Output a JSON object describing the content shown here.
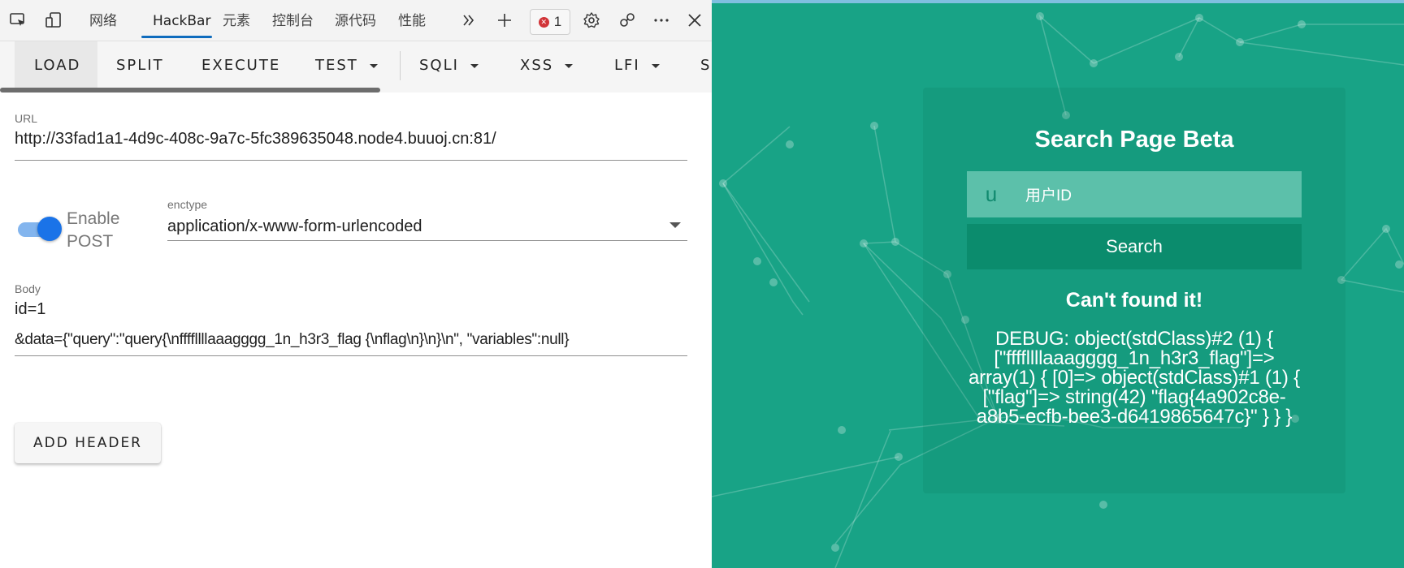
{
  "devtools": {
    "tabs": [
      "网络",
      "HackBar",
      "元素",
      "控制台",
      "源代码",
      "性能"
    ],
    "active_tab": "HackBar",
    "error_count": "1",
    "toolbar": {
      "load": "LOAD",
      "split": "SPLIT",
      "execute": "EXECUTE",
      "test": "TEST",
      "sqli": "SQLI",
      "xss": "XSS",
      "lfi": "LFI",
      "more": "S"
    },
    "url": {
      "label": "URL",
      "value": "http://33fad1a1-4d9c-408c-9a7c-5fc389635048.node4.buuoj.cn:81/"
    },
    "post": {
      "toggle_label": "Enable POST",
      "enabled": true,
      "enctype_label": "enctype",
      "enctype_value": "application/x-www-form-urlencoded"
    },
    "body": {
      "label": "Body",
      "line1": "id=1",
      "line2": "&data={\"query\":\"query{\\nffffllllaaagggg_1n_h3r3_flag {\\nflag\\n}\\n}\\n\", \"variables\":null}"
    },
    "add_header_label": "ADD HEADER"
  },
  "page": {
    "title": "Search Page Beta",
    "input_icon": "u",
    "input_placeholder": "用户ID",
    "search_button": "Search",
    "result_title": "Can't found it!",
    "debug": "DEBUG: object(stdClass)#2 (1) { [\"ffffllllaaagggg_1n_h3r3_flag\"]=> array(1) { [0]=> object(stdClass)#1 (1) { [\"flag\"]=> string(42) \"flag{4a902c8e-a8b5-ecfb-bee3-d6419865647c}\" } } }"
  },
  "colors": {
    "page_background": "#18a386",
    "search_button": "#0b8c6d",
    "toggle_on": "#1a73e8",
    "tab_underline": "#0f6cbd"
  }
}
